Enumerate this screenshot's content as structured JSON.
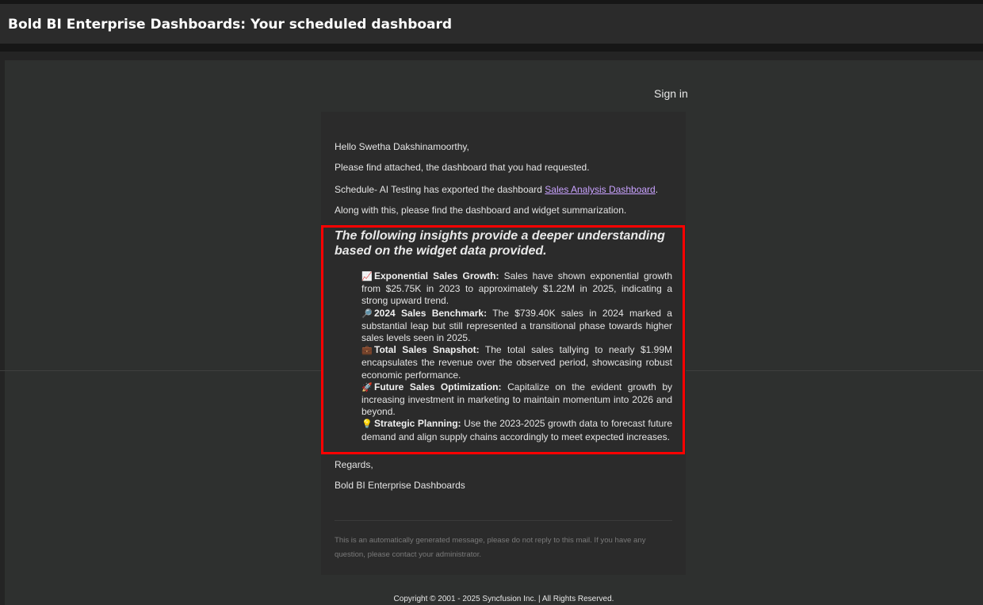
{
  "email": {
    "subject": "Bold BI Enterprise Dashboards: Your scheduled dashboard",
    "sign_in": "Sign in",
    "greeting": "Hello Swetha Dakshinamoorthy,",
    "line1": "Please find attached, the dashboard that you had requested.",
    "line2_prefix": "Schedule- AI Testing has exported the dashboard ",
    "line2_link": "Sales Analysis Dashboard",
    "line2_suffix": ".",
    "line3": "Along with this, please find the dashboard and widget summarization.",
    "insights_heading": "The following insights provide a deeper understanding based on the widget data provided.",
    "insights": [
      {
        "icon": "chart-increasing-icon",
        "glyph": "📈",
        "title": "Exponential Sales Growth:",
        "text": "Sales have shown exponential growth from $25.75K in 2023 to approximately $1.22M in 2025, indicating a strong upward trend."
      },
      {
        "icon": "magnifying-glass-icon",
        "glyph": "🔎",
        "title": "2024 Sales Benchmark:",
        "text": "The $739.40K sales in 2024 marked a substantial leap but still represented a transitional phase towards higher sales levels seen in 2025."
      },
      {
        "icon": "briefcase-icon",
        "glyph": "💼",
        "title": "Total Sales Snapshot:",
        "text": "The total sales tallying to nearly $1.99M encapsulates the revenue over the observed period, showcasing robust economic performance."
      },
      {
        "icon": "rocket-icon",
        "glyph": "🚀",
        "title": "Future Sales Optimization:",
        "text": "Capitalize on the evident growth by increasing investment in marketing to maintain momentum into 2026 and beyond."
      },
      {
        "icon": "light-bulb-icon",
        "glyph": "💡",
        "title": "Strategic Planning:",
        "text": "Use the 2023-2025 growth data to forecast future demand and align supply chains accordingly to meet expected increases."
      }
    ],
    "regards": "Regards,",
    "signature": "Bold BI Enterprise Dashboards",
    "auto_note": "This is an automatically generated message, please do not reply to this mail. If you have any question, please contact your administrator.",
    "copyright": "Copyright © 2001 - 2025 Syncfusion Inc. | All Rights Reserved."
  },
  "colors": {
    "highlight_border": "#ff0000",
    "link": "#c9a2ff"
  }
}
